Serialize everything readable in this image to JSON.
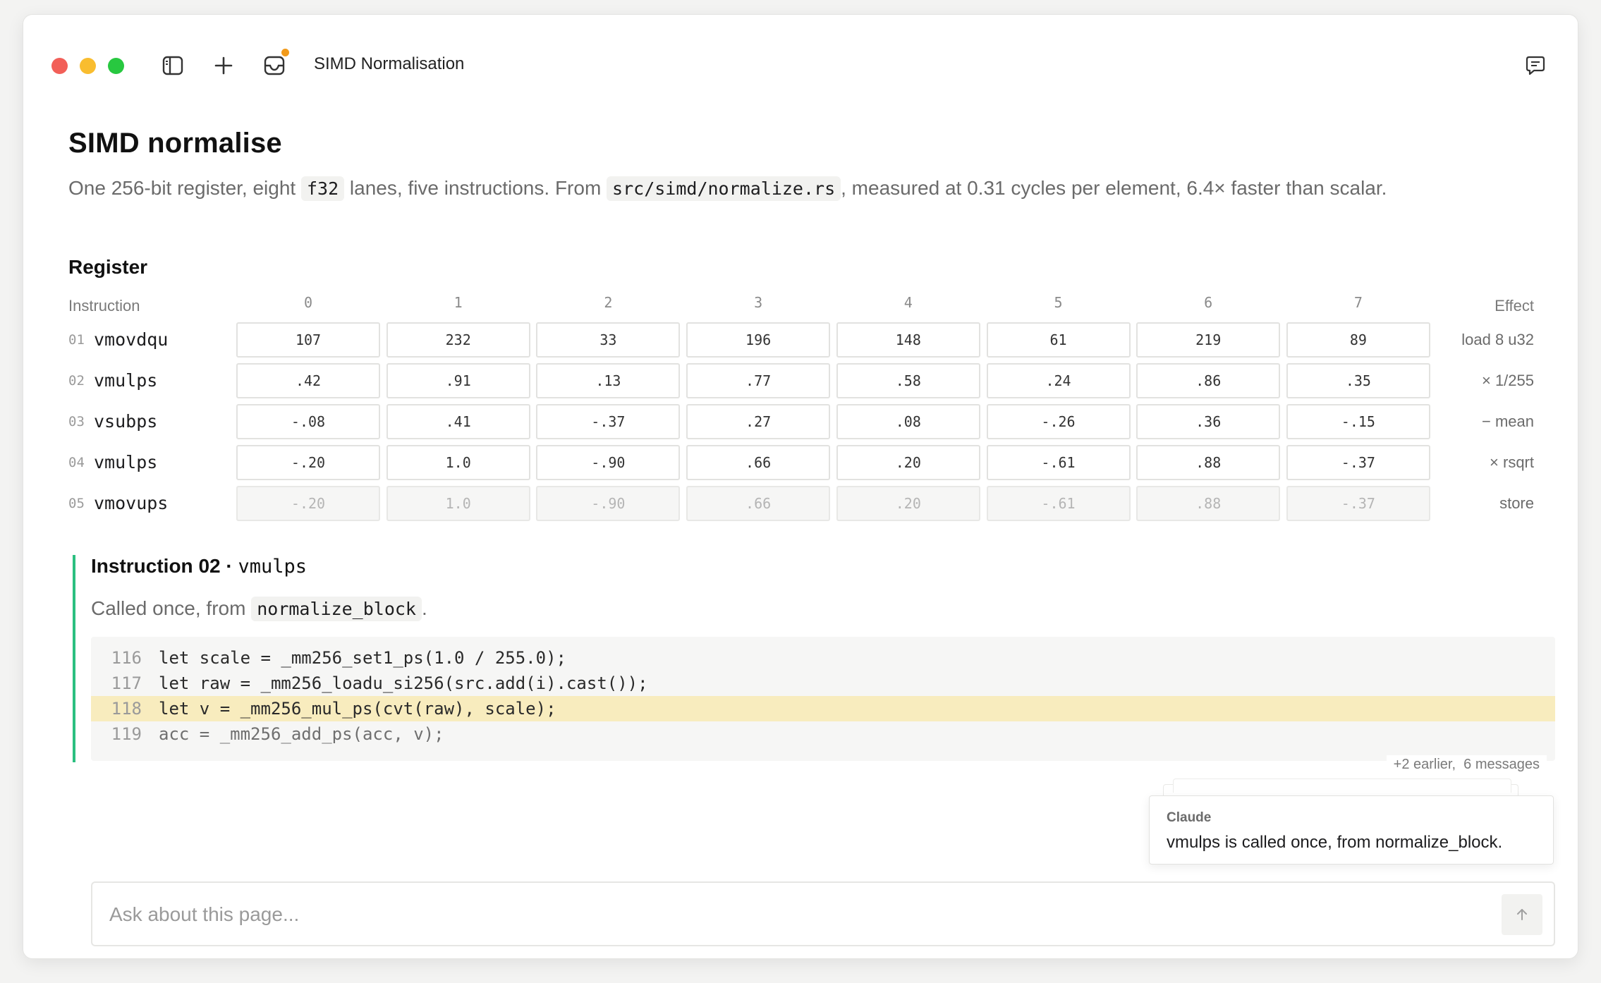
{
  "window": {
    "title": "SIMD Normalisation"
  },
  "page": {
    "title": "SIMD normalise",
    "subtitle": {
      "pre": "One 256-bit register, eight ",
      "type_code": "f32",
      "mid": " lanes, five instructions. From ",
      "path_code": "src/simd/normalize.rs",
      "post": ", measured at 0.31 cycles per element, 6.4× faster than scalar."
    }
  },
  "register": {
    "heading": "Register",
    "col_instruction": "Instruction",
    "col_effect": "Effect",
    "lanes": [
      "0",
      "1",
      "2",
      "3",
      "4",
      "5",
      "6",
      "7"
    ],
    "rows": [
      {
        "num": "01",
        "name": "vmovdqu",
        "values": [
          "107",
          "232",
          "33",
          "196",
          "148",
          "61",
          "219",
          "89"
        ],
        "effect": "load 8 u32",
        "faded": false
      },
      {
        "num": "02",
        "name": "vmulps",
        "values": [
          ".42",
          ".91",
          ".13",
          ".77",
          ".58",
          ".24",
          ".86",
          ".35"
        ],
        "effect": "× 1/255",
        "faded": false
      },
      {
        "num": "03",
        "name": "vsubps",
        "values": [
          "-.08",
          ".41",
          "-.37",
          ".27",
          ".08",
          "-.26",
          ".36",
          "-.15"
        ],
        "effect": "− mean",
        "faded": false
      },
      {
        "num": "04",
        "name": "vmulps",
        "values": [
          "-.20",
          "1.0",
          "-.90",
          ".66",
          ".20",
          "-.61",
          ".88",
          "-.37"
        ],
        "effect": "× rsqrt",
        "faded": false
      },
      {
        "num": "05",
        "name": "vmovups",
        "values": [
          "-.20",
          "1.0",
          "-.90",
          ".66",
          ".20",
          "-.61",
          ".88",
          "-.37"
        ],
        "effect": "store",
        "faded": true
      }
    ]
  },
  "detail": {
    "title_prefix": "Instruction 02 · ",
    "title_mono": "vmulps",
    "called_pre": "Called once, from ",
    "called_code": "normalize_block",
    "called_post": ".",
    "code_lines": [
      {
        "ln": "116",
        "src": "let scale = _mm256_set1_ps(1.0 / 255.0);",
        "highlight": false,
        "dim": false
      },
      {
        "ln": "117",
        "src": "let raw = _mm256_loadu_si256(src.add(i).cast());",
        "highlight": false,
        "dim": false
      },
      {
        "ln": "118",
        "src": "let v = _mm256_mul_ps(cvt(raw), scale);",
        "highlight": true,
        "dim": false
      },
      {
        "ln": "119",
        "src": "acc = _mm256_add_ps(acc, v);",
        "highlight": false,
        "dim": true
      }
    ],
    "earlier_note": "+2 earlier,  6 messages"
  },
  "claude_card": {
    "name": "Claude",
    "message": "vmulps is called once, from normalize_block."
  },
  "ask": {
    "placeholder": "Ask about this page..."
  },
  "icons": {
    "sidebar": "sidebar-toggle-icon",
    "plus": "plus-icon",
    "inbox": "inbox-icon",
    "chat": "chat-icon",
    "send": "arrow-up-icon"
  },
  "colors": {
    "accent_bar": "#2bbf80",
    "highlight": "#f8ecbe",
    "notify_dot": "#f29a1a"
  }
}
